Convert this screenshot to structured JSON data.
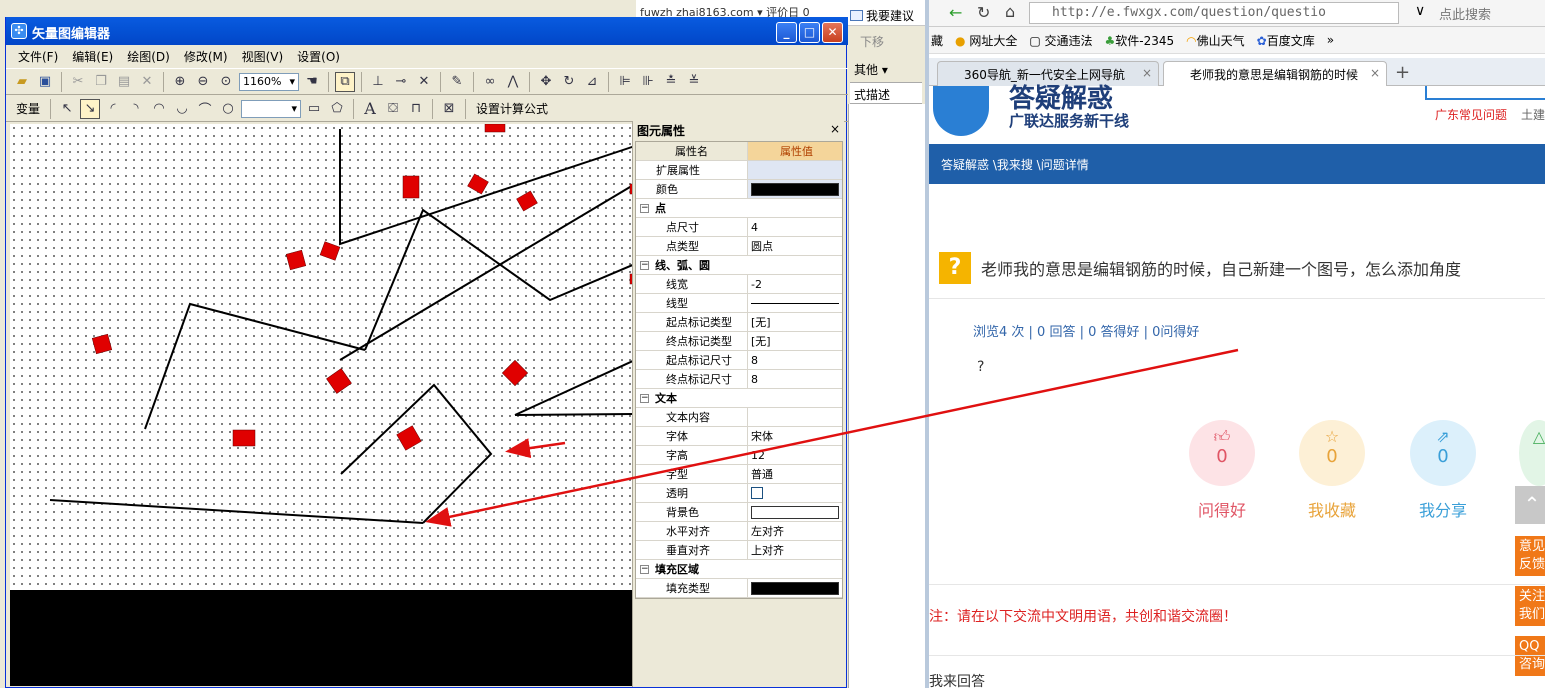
{
  "background_app": {
    "top_strip_text": "fuwzh zhai8163.com  ▾  评价日 0",
    "report_label": "我要建议",
    "move_down_label": "下移",
    "other_label": "其他",
    "desc_label": "式描述"
  },
  "window": {
    "title": "矢量图编辑器",
    "app_icon_char": "✣",
    "minimize": "_",
    "maximize": "□",
    "close": "✕"
  },
  "menu": {
    "items": [
      "文件(F)",
      "编辑(E)",
      "绘图(D)",
      "修改(M)",
      "视图(V)",
      "设置(O)"
    ]
  },
  "toolbar1": {
    "zoom_value": "1160%"
  },
  "toolbar2": {
    "variable_label": "变量",
    "formula_label": "设置计算公式"
  },
  "props": {
    "title": "图元属性",
    "close": "×",
    "header_name": "属性名",
    "header_value": "属性值",
    "rows": {
      "ext": "扩展属性",
      "color": "颜色",
      "point_cat": "点",
      "point_size": "点尺寸",
      "point_size_val": "4",
      "point_type": "点类型",
      "point_type_val": "圆点",
      "line_cat": "线、弧、圆",
      "line_width": "线宽",
      "line_width_val": "-2",
      "line_type": "线型",
      "start_mark_type": "起点标记类型",
      "start_mark_type_val": "[无]",
      "end_mark_type": "终点标记类型",
      "end_mark_type_val": "[无]",
      "start_mark_size": "起点标记尺寸",
      "start_mark_size_val": "8",
      "end_mark_size": "终点标记尺寸",
      "end_mark_size_val": "8",
      "text_cat": "文本",
      "text_content": "文本内容",
      "font": "字体",
      "font_val": "宋体",
      "font_height": "字高",
      "font_height_val": "12",
      "font_style": "字型",
      "font_style_val": "普通",
      "transparent": "透明",
      "bg_color": "背景色",
      "h_align": "水平对齐",
      "h_align_val": "左对齐",
      "v_align": "垂直对齐",
      "v_align_val": "上对齐",
      "fill_cat": "填充区域",
      "fill_type": "填充类型"
    }
  },
  "browser": {
    "url": "http://e.fwxgx.com/question/questio",
    "search_placeholder": "点此搜索",
    "bookmarks": [
      "藏",
      "网址大全",
      "交通违法",
      "软件-2345",
      "佛山天气",
      "百度文库"
    ],
    "tabs": [
      "360导航_新一代安全上网导航",
      "老师我的意思是编辑钢筋的时候"
    ],
    "site_slogan": "广联达服务新干线",
    "site_logo_text": "答疑解惑",
    "site_link": "广东常见问题",
    "site_link2": "土建",
    "breadcrumb": "答疑解惑 \\我来搜 \\问题详情",
    "question": "老师我的意思是编辑钢筋的时候，自己新建一个图号，怎么添加角度",
    "stats": "浏览4 次 | 0 回答 | 0 答得好 | 0问得好",
    "body": "?",
    "actions": [
      {
        "label": "问得好",
        "count": "0"
      },
      {
        "label": "我收藏",
        "count": "0"
      },
      {
        "label": "我分享",
        "count": "0"
      }
    ],
    "side_buttons": [
      "意见反馈",
      "关注我们",
      "QQ咨询"
    ],
    "notice": "注：请在以下交流中文明用语，共创和谐交流圈！",
    "answer_heading": "我来回答"
  },
  "colors": {
    "title_blue": "#0553d6",
    "annotation_red": "#e01010",
    "nav_blue": "#1f5fa9",
    "accent_orange": "#f5b400"
  }
}
